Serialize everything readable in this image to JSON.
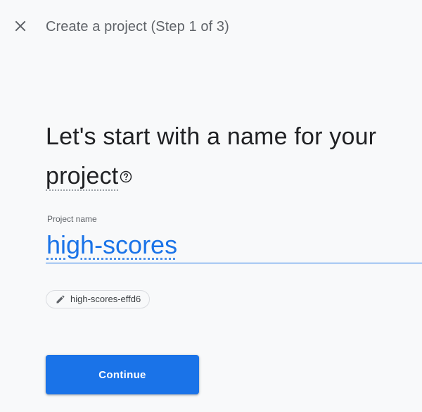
{
  "header": {
    "close_icon": "close-icon",
    "title": "Create a project (Step 1 of 3)"
  },
  "main": {
    "headline_prefix": "Let's start with a name for your ",
    "headline_term": "project",
    "help_icon": "help-circle-icon",
    "field_label": "Project name",
    "project_name_value": "high-scores",
    "project_id_chip": {
      "icon": "pencil-icon",
      "text": "high-scores-effd6"
    },
    "continue_label": "Continue"
  },
  "colors": {
    "accent": "#1a73e8",
    "background": "#f8f9fa",
    "text": "#202124",
    "muted": "#5f6368"
  }
}
